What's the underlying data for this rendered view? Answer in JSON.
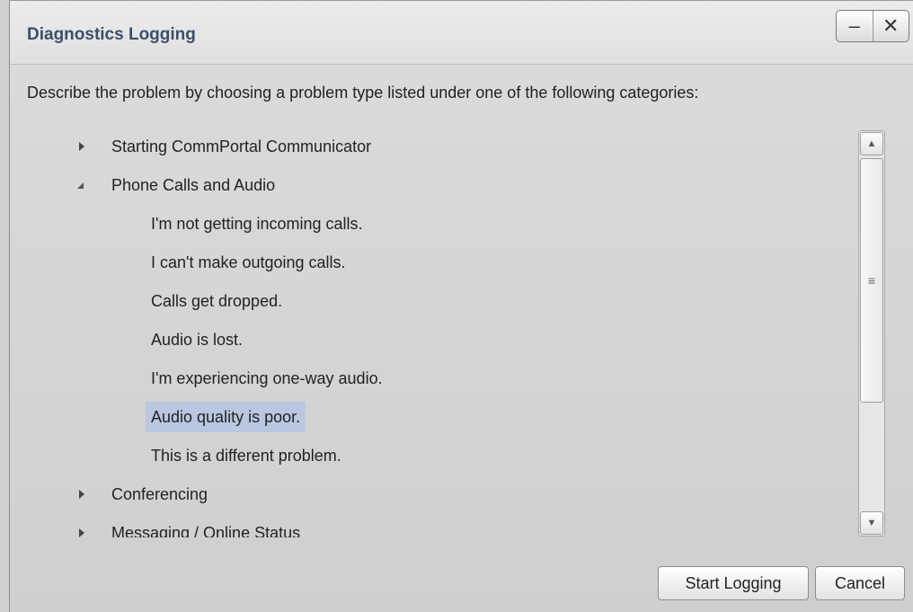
{
  "window": {
    "title": "Diagnostics Logging",
    "minimize_label": "–",
    "close_label": "✕"
  },
  "description": "Describe the problem by choosing a problem type listed under one of the following categories:",
  "categories": [
    {
      "label": "Starting CommPortal Communicator",
      "expanded": false
    },
    {
      "label": "Phone Calls and Audio",
      "expanded": true,
      "items": [
        {
          "label": "I'm not getting incoming calls.",
          "selected": false
        },
        {
          "label": "I can't make outgoing calls.",
          "selected": false
        },
        {
          "label": "Calls get dropped.",
          "selected": false
        },
        {
          "label": "Audio is lost.",
          "selected": false
        },
        {
          "label": "I'm experiencing one-way audio.",
          "selected": false
        },
        {
          "label": "Audio quality is poor.",
          "selected": true
        },
        {
          "label": "This is a different problem.",
          "selected": false
        }
      ]
    },
    {
      "label": "Conferencing",
      "expanded": false
    },
    {
      "label": "Messaging / Online Status",
      "expanded": false
    }
  ],
  "scrollbar": {
    "up_glyph": "▲",
    "down_glyph": "▼",
    "grip_glyph": "≡"
  },
  "buttons": {
    "start_logging": "Start Logging",
    "cancel": "Cancel"
  },
  "colors": {
    "title_text": "#3b4f6b",
    "selection": "#b9c7e0"
  }
}
